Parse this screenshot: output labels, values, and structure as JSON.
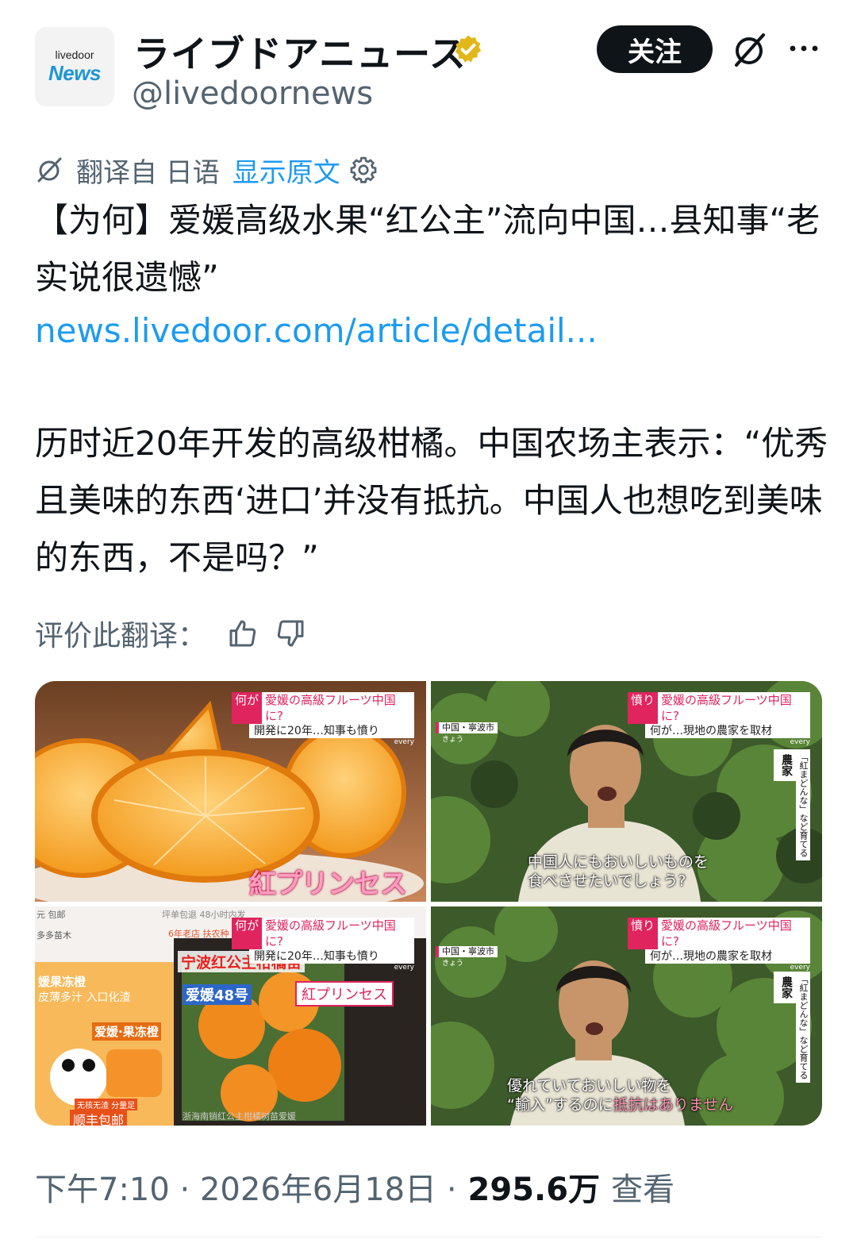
{
  "account": {
    "avatar_line1": "livedoor",
    "avatar_line2": "News",
    "name": "ライブドアニュース",
    "handle": "@livedoornews",
    "follow_label": "关注"
  },
  "translation": {
    "label": "翻译自 日语",
    "show_original": "显示原文"
  },
  "post": {
    "headline": "【为何】爱媛高级水果“红公主”流向中国…县知事“老实说很遗憾”",
    "link": "news.livedoor.com/article/detail...",
    "body": "历时近20年开发的高级柑橘。中国农场主表示：“优秀且美味的东西‘进口’并没有抵抗。中国人也想吃到美味的东西，不是吗？”"
  },
  "rating": {
    "label": "评价此翻译："
  },
  "media": [
    {
      "tag": "何が",
      "title": "愛媛の高級フルーツ中国に?",
      "subtitle": "開発に20年…知事も憤り",
      "brand": "every",
      "caption": "紅プリンセス"
    },
    {
      "tag": "憤り",
      "title": "愛媛の高級フルーツ中国に?",
      "subtitle": "何が…現地の農家を取材",
      "brand": "every",
      "location": "中国・寧波市",
      "location_sub": "きょう",
      "side_label": "「紅まどんな」など育てる",
      "side_role": "農家",
      "subtitle_line1": "中国人にもおいしいものを",
      "subtitle_line2": "食べさせたいでしょう?"
    },
    {
      "tag": "何が",
      "title": "愛媛の高級フルーツ中国に?",
      "subtitle": "開発に20年…知事も憤り",
      "brand": "every",
      "box_text1": "媛果冻橙",
      "box_text2": "皮薄多汁 入口化渣",
      "box_brand": "爱媛·果冻橙",
      "box_badge": "无核无渣 分量足",
      "shipping": "顺丰包邮",
      "product_title": "宁波红公主柑橘苗",
      "product_variety": "爱媛48号",
      "callout": "紅プリンセス",
      "listing_bottom": "浙海南销红公主柑橘树苗爱媛",
      "top_strip_left": "元 包邮",
      "top_strip_mid": "坪单包退  48小时内发",
      "shop_left": "多多苗木",
      "shop_mid": "6年老店 扶农种"
    },
    {
      "tag": "憤り",
      "title": "愛媛の高級フルーツ中国に?",
      "subtitle": "何が…現地の農家を取材",
      "brand": "every",
      "location": "中国・寧波市",
      "location_sub": "きょう",
      "side_label": "「紅まどんな」など育てる",
      "side_role": "農家",
      "subtitle_line1": "優れていておいしい物を",
      "subtitle_line2_a": "“輸入”するのに",
      "subtitle_line2_b": "抵抗はありません"
    }
  ],
  "footer": {
    "time": "下午7:10 · 2026年6月18日 ·",
    "views": "295.6万",
    "views_label": "查看"
  },
  "colors": {
    "link": "#1d9bf0",
    "secondary": "#536471",
    "verified_gold": "#e2b719",
    "caption_red": "#e0245e"
  }
}
